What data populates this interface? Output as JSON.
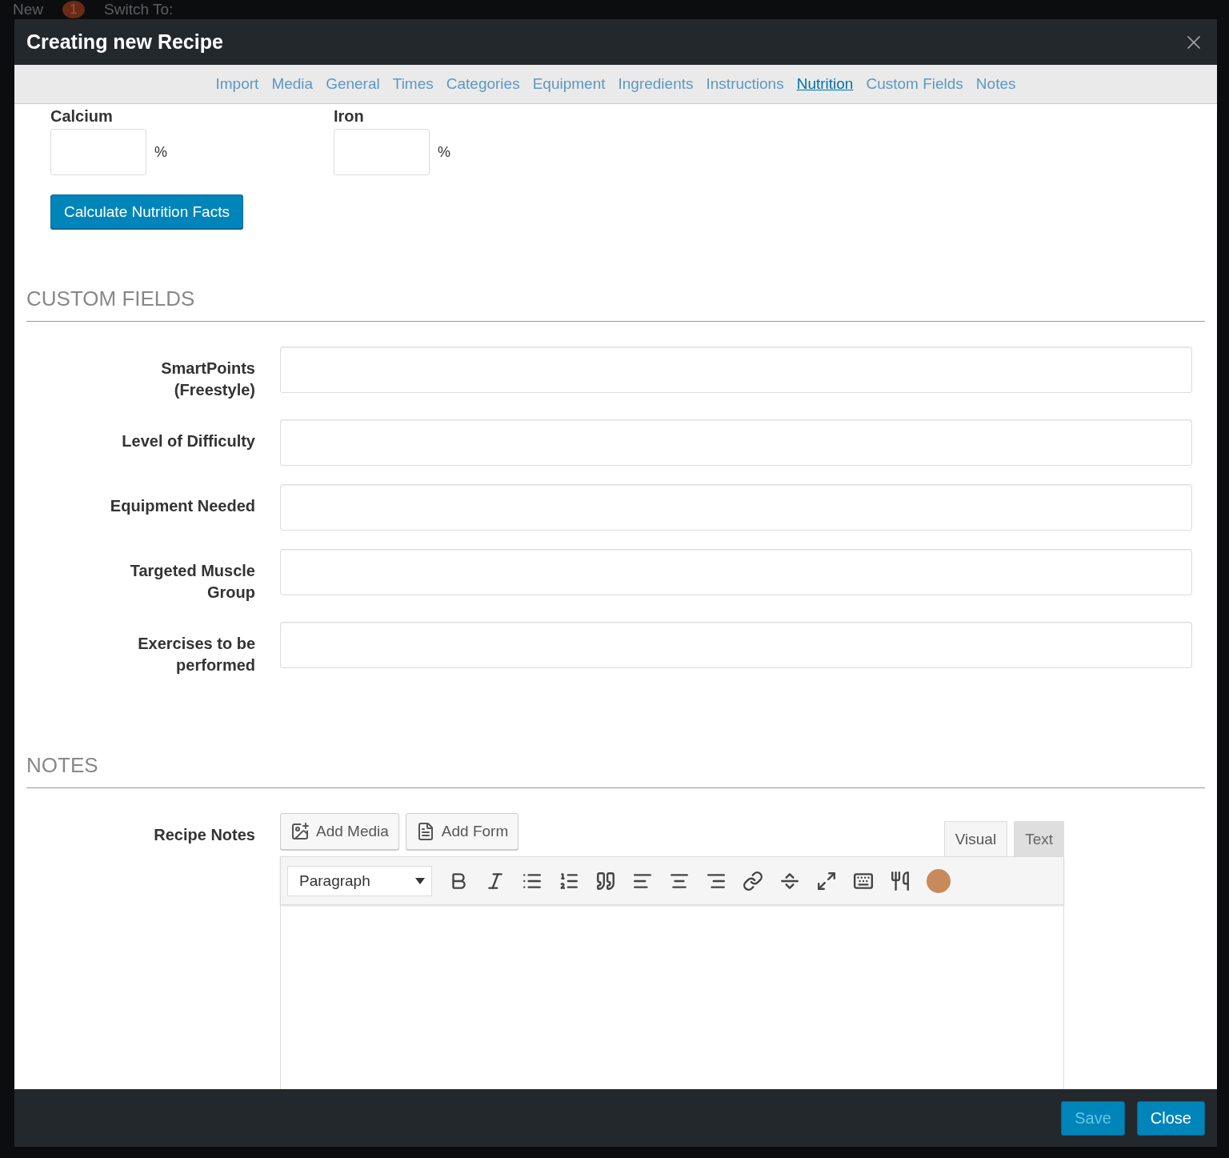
{
  "admin_bar": {
    "items": [
      "New",
      "Switch To:"
    ],
    "badge": "1"
  },
  "window": {
    "title": "Creating new Recipe"
  },
  "tabs": [
    {
      "label": "Import",
      "selected": false
    },
    {
      "label": "Media",
      "selected": false
    },
    {
      "label": "General",
      "selected": false
    },
    {
      "label": "Times",
      "selected": false
    },
    {
      "label": "Categories",
      "selected": false
    },
    {
      "label": "Equipment",
      "selected": false
    },
    {
      "label": "Ingredients",
      "selected": false
    },
    {
      "label": "Instructions",
      "selected": false
    },
    {
      "label": "Nutrition",
      "selected": true
    },
    {
      "label": "Custom Fields",
      "selected": false
    },
    {
      "label": "Notes",
      "selected": false
    }
  ],
  "nutrition": {
    "fields": [
      {
        "label": "Calcium",
        "unit": "%"
      },
      {
        "label": "Iron",
        "unit": "%"
      }
    ],
    "calculate_button": "Calculate Nutrition Facts"
  },
  "custom_fields": {
    "title": "CUSTOM FIELDS",
    "fields": [
      {
        "label": "SmartPoints (Freestyle)"
      },
      {
        "label": "Level of Difficulty"
      },
      {
        "label": "Equipment Needed"
      },
      {
        "label": "Targeted Muscle Group"
      },
      {
        "label": "Exercises to be performed"
      }
    ]
  },
  "notes": {
    "title": "NOTES",
    "label": "Recipe Notes",
    "media_buttons": [
      {
        "label": "Add Media",
        "kind": "media"
      },
      {
        "label": "Add Form",
        "kind": "form"
      }
    ],
    "editor_tabs": [
      {
        "label": "Visual",
        "selected": true
      },
      {
        "label": "Text",
        "selected": false
      }
    ],
    "format_select": "Paragraph"
  },
  "footer": {
    "buttons": [
      {
        "label": "Save",
        "disabled": true
      },
      {
        "label": "Close",
        "disabled": false
      }
    ]
  }
}
